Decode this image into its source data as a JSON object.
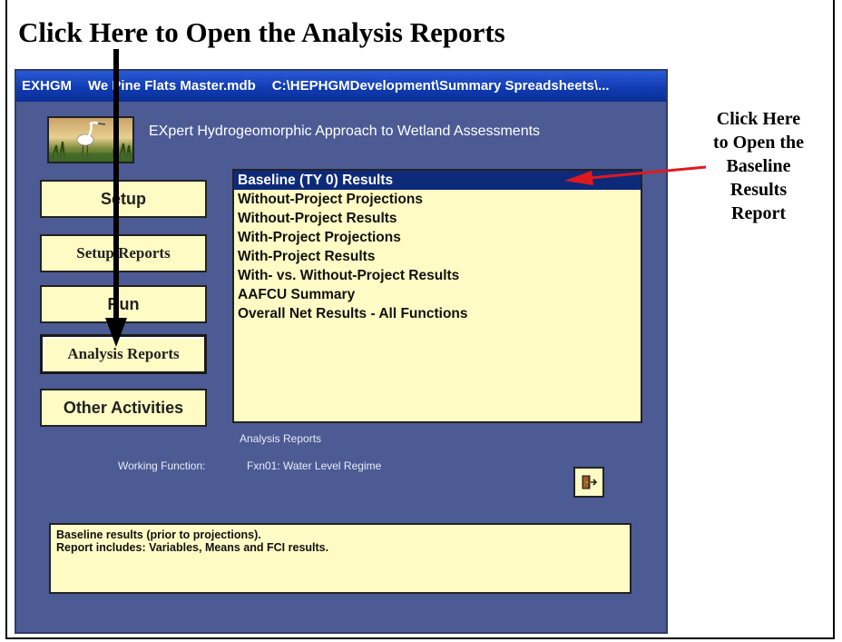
{
  "callouts": {
    "top": "Click Here to Open the Analysis Reports",
    "right_lines": [
      "Click Here",
      "to Open the",
      "Baseline",
      "Results",
      "Report"
    ]
  },
  "titlebar": {
    "app": "EXHGM",
    "db": "We  Pine Flats Master.mdb",
    "path": "C:\\HEPHGMDevelopment\\Summary Spreadsheets\\..."
  },
  "app_title": "EXpert Hydrogeomorphic Approach to Wetland Assessments",
  "nav": {
    "setup": "Setup",
    "setup_reports": "Setup Reports",
    "run": "Run",
    "analysis_reports": "Analysis Reports",
    "other_activities": "Other Activities"
  },
  "reports_list": [
    "Baseline (TY 0) Results",
    "Without-Project Projections",
    "Without-Project Results",
    "With-Project Projections",
    "With-Project Results",
    "With- vs. Without-Project Results",
    "AAFCU Summary",
    "Overall Net Results - All Functions"
  ],
  "list_caption": "Analysis Reports",
  "working_function": {
    "label": "Working Function:",
    "value": "Fxn01:  Water Level Regime"
  },
  "description": {
    "line1": "Baseline results (prior to projections).",
    "line2": "Report includes:  Variables, Means and FCI results."
  },
  "colors": {
    "window_bg": "#4c5b94",
    "button_bg": "#fffbc4",
    "selected_bg": "#0d2a7a",
    "titlebar": "#0f3ab0",
    "arrow_red": "#e0191e"
  },
  "icons": {
    "exit": "exit-door-icon",
    "logo": "heron-wetland-logo"
  }
}
